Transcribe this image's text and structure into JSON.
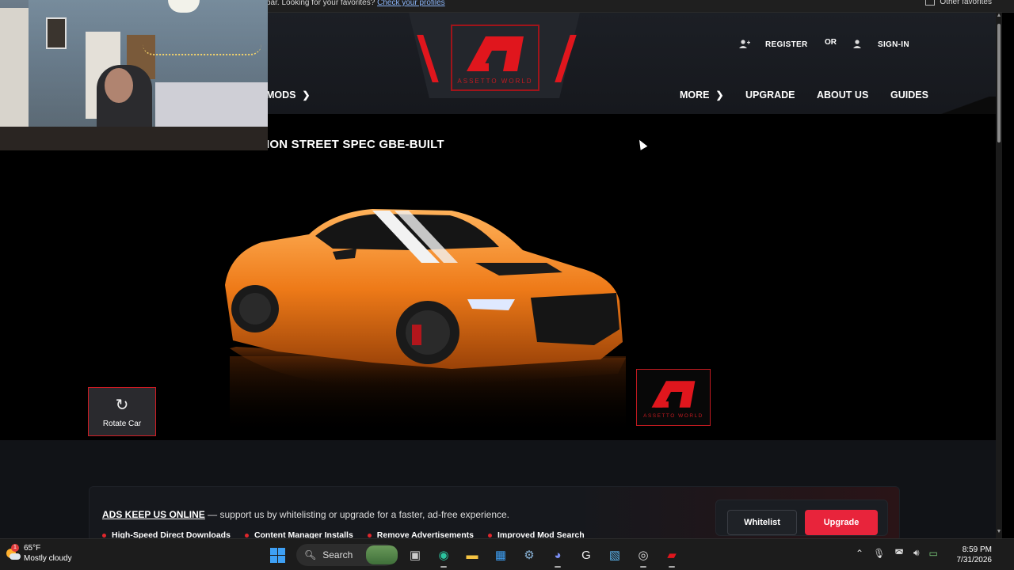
{
  "favorites_bar": {
    "message": "bar. Looking for your favorites?",
    "link": "Check your profiles",
    "other": "Other favorites"
  },
  "header": {
    "logo_text": "ASSETTO WORLD",
    "register": "REGISTER",
    "or": "OR",
    "signin": "SIGN-IN",
    "nav": {
      "mods": "MODS",
      "more": "MORE",
      "upgrade": "UPGRADE",
      "about": "ABOUT US",
      "guides": "GUIDES"
    }
  },
  "car": {
    "title": "ION STREET SPEC GBE-BUILT",
    "rotate_label": "Rotate Car",
    "watermark_text": "ASSETTO WORLD",
    "body_color": "#ee7a18"
  },
  "ad": {
    "headline": "ADS KEEP US ONLINE",
    "message": " — support us by whitelisting or upgrade for a faster, ad-free experience.",
    "features": [
      "High-Speed Direct Downloads",
      "Content Manager Installs",
      "Remove Advertisements",
      "Improved Mod Search"
    ],
    "whitelist_label": "Whitelist",
    "upgrade_label": "Upgrade",
    "accent": "#e8243b"
  },
  "taskbar": {
    "temperature": "65°F",
    "weather": "Mostly cloudy",
    "weather_badge": "1",
    "search_label": "Search",
    "time": "8:59 PM",
    "date": "7/31/2026"
  }
}
